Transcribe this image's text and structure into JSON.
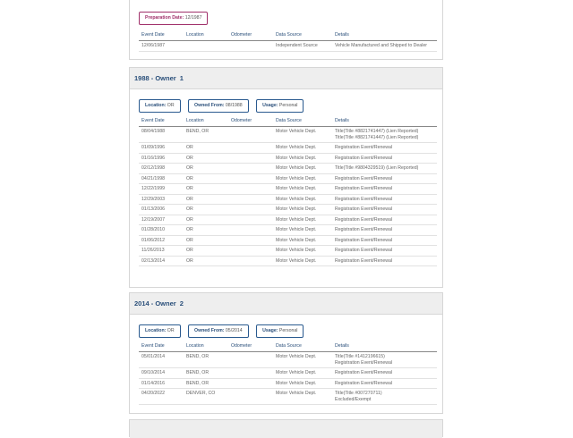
{
  "columns": [
    "Event Date",
    "Location",
    "Odometer",
    "Data Source",
    "Details"
  ],
  "section0": {
    "prep_label": "Preparation Date:",
    "prep_value": "12/1987",
    "rows": [
      {
        "date": "12/06/1987",
        "location": "",
        "odometer": "",
        "source": "Independent Source",
        "details": [
          "Vehicle Manufactured and Shipped to Dealer"
        ]
      }
    ]
  },
  "owner1": {
    "title": "1988 - Owner",
    "number": "1",
    "location_label": "Location:",
    "location_value": "OR",
    "owned_label": "Owned From:",
    "owned_value": "08/1988",
    "usage_label": "Usage:",
    "usage_value": "Personal",
    "rows": [
      {
        "date": "08/04/1988",
        "location": "BEND, OR",
        "odometer": "",
        "source": "Motor Vehicle Dept.",
        "details": [
          "Title(Title #8821741447) (Lien Reported)",
          "Title(Title #8821741447) (Lien Reported)"
        ]
      },
      {
        "date": "01/09/1996",
        "location": "OR",
        "odometer": "",
        "source": "Motor Vehicle Dept.",
        "details": [
          "Registration Event/Renewal"
        ]
      },
      {
        "date": "01/16/1996",
        "location": "OR",
        "odometer": "",
        "source": "Motor Vehicle Dept.",
        "details": [
          "Registration Event/Renewal"
        ]
      },
      {
        "date": "02/12/1998",
        "location": "OR",
        "odometer": "",
        "source": "Motor Vehicle Dept.",
        "details": [
          "Title(Title #9804329519) (Lien Reported)"
        ]
      },
      {
        "date": "04/21/1998",
        "location": "OR",
        "odometer": "",
        "source": "Motor Vehicle Dept.",
        "details": [
          "Registration Event/Renewal"
        ]
      },
      {
        "date": "12/22/1999",
        "location": "OR",
        "odometer": "",
        "source": "Motor Vehicle Dept.",
        "details": [
          "Registration Event/Renewal"
        ]
      },
      {
        "date": "12/29/2003",
        "location": "OR",
        "odometer": "",
        "source": "Motor Vehicle Dept.",
        "details": [
          "Registration Event/Renewal"
        ]
      },
      {
        "date": "01/13/2006",
        "location": "OR",
        "odometer": "",
        "source": "Motor Vehicle Dept.",
        "details": [
          "Registration Event/Renewal"
        ]
      },
      {
        "date": "12/19/2007",
        "location": "OR",
        "odometer": "",
        "source": "Motor Vehicle Dept.",
        "details": [
          "Registration Event/Renewal"
        ]
      },
      {
        "date": "01/28/2010",
        "location": "OR",
        "odometer": "",
        "source": "Motor Vehicle Dept.",
        "details": [
          "Registration Event/Renewal"
        ]
      },
      {
        "date": "01/06/2012",
        "location": "OR",
        "odometer": "",
        "source": "Motor Vehicle Dept.",
        "details": [
          "Registration Event/Renewal"
        ]
      },
      {
        "date": "11/26/2013",
        "location": "OR",
        "odometer": "",
        "source": "Motor Vehicle Dept.",
        "details": [
          "Registration Event/Renewal"
        ]
      },
      {
        "date": "02/13/2014",
        "location": "OR",
        "odometer": "",
        "source": "Motor Vehicle Dept.",
        "details": [
          "Registration Event/Renewal"
        ]
      }
    ]
  },
  "owner2": {
    "title": "2014 - Owner",
    "number": "2",
    "location_label": "Location:",
    "location_value": "OR",
    "owned_label": "Owned From:",
    "owned_value": "05/2014",
    "usage_label": "Usage:",
    "usage_value": "Personal",
    "rows": [
      {
        "date": "05/01/2014",
        "location": "BEND, OR",
        "odometer": "",
        "source": "Motor Vehicle Dept.",
        "details": [
          "Title(Title #1412196615)",
          "Registration Event/Renewal"
        ]
      },
      {
        "date": "09/10/2014",
        "location": "BEND, OR",
        "odometer": "",
        "source": "Motor Vehicle Dept.",
        "details": [
          "Registration Event/Renewal"
        ]
      },
      {
        "date": "01/14/2016",
        "location": "BEND, OR",
        "odometer": "",
        "source": "Motor Vehicle Dept.",
        "details": [
          "Registration Event/Renewal"
        ]
      },
      {
        "date": "04/20/2022",
        "location": "DENVER, CO",
        "odometer": "",
        "source": "Motor Vehicle Dept.",
        "details": [
          "Title(Title #007270711)",
          "Excluded/Exempt"
        ]
      }
    ]
  },
  "colors": {
    "header_text": "#2a4f7a",
    "badge_border": "#2a5a8f",
    "prep_border": "#a0306a",
    "header_bg": "#eeeeee"
  }
}
